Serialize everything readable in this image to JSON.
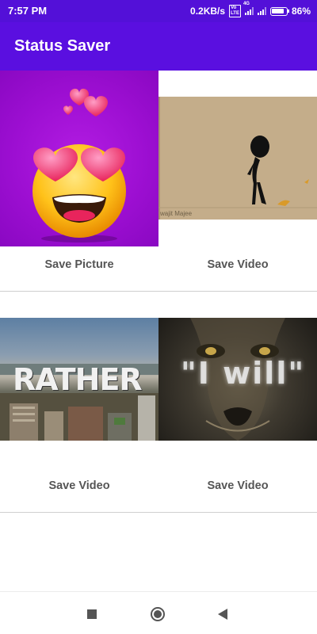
{
  "status_bar": {
    "time": "7:57 PM",
    "network_speed": "0.2KB/s",
    "volte_badge": "Vo LTE",
    "signal_tag": "4G",
    "battery_percent": "86%"
  },
  "app_bar": {
    "title": "Status Saver"
  },
  "items": [
    {
      "type": "picture",
      "thumbnail": "heart-eyes-emoji",
      "action_label": "Save Picture"
    },
    {
      "type": "video",
      "thumbnail": "stick-figure-animation",
      "caption": "wajit Majee",
      "action_label": "Save Video"
    },
    {
      "type": "video",
      "thumbnail": "city-skyline-rather",
      "overlay_text": "RATHER",
      "action_label": "Save Video"
    },
    {
      "type": "video",
      "thumbnail": "lion-i-will",
      "overlay_text": "\"I will\"",
      "action_label": "Save Video"
    }
  ],
  "nav_bar": {
    "recents_icon": "square-icon",
    "home_icon": "circle-icon",
    "back_icon": "triangle-back-icon"
  },
  "colors": {
    "status_bar": "#5310d8",
    "app_bar": "#5a0fe0",
    "label_text": "#555555",
    "divider": "#cfcfcf"
  }
}
